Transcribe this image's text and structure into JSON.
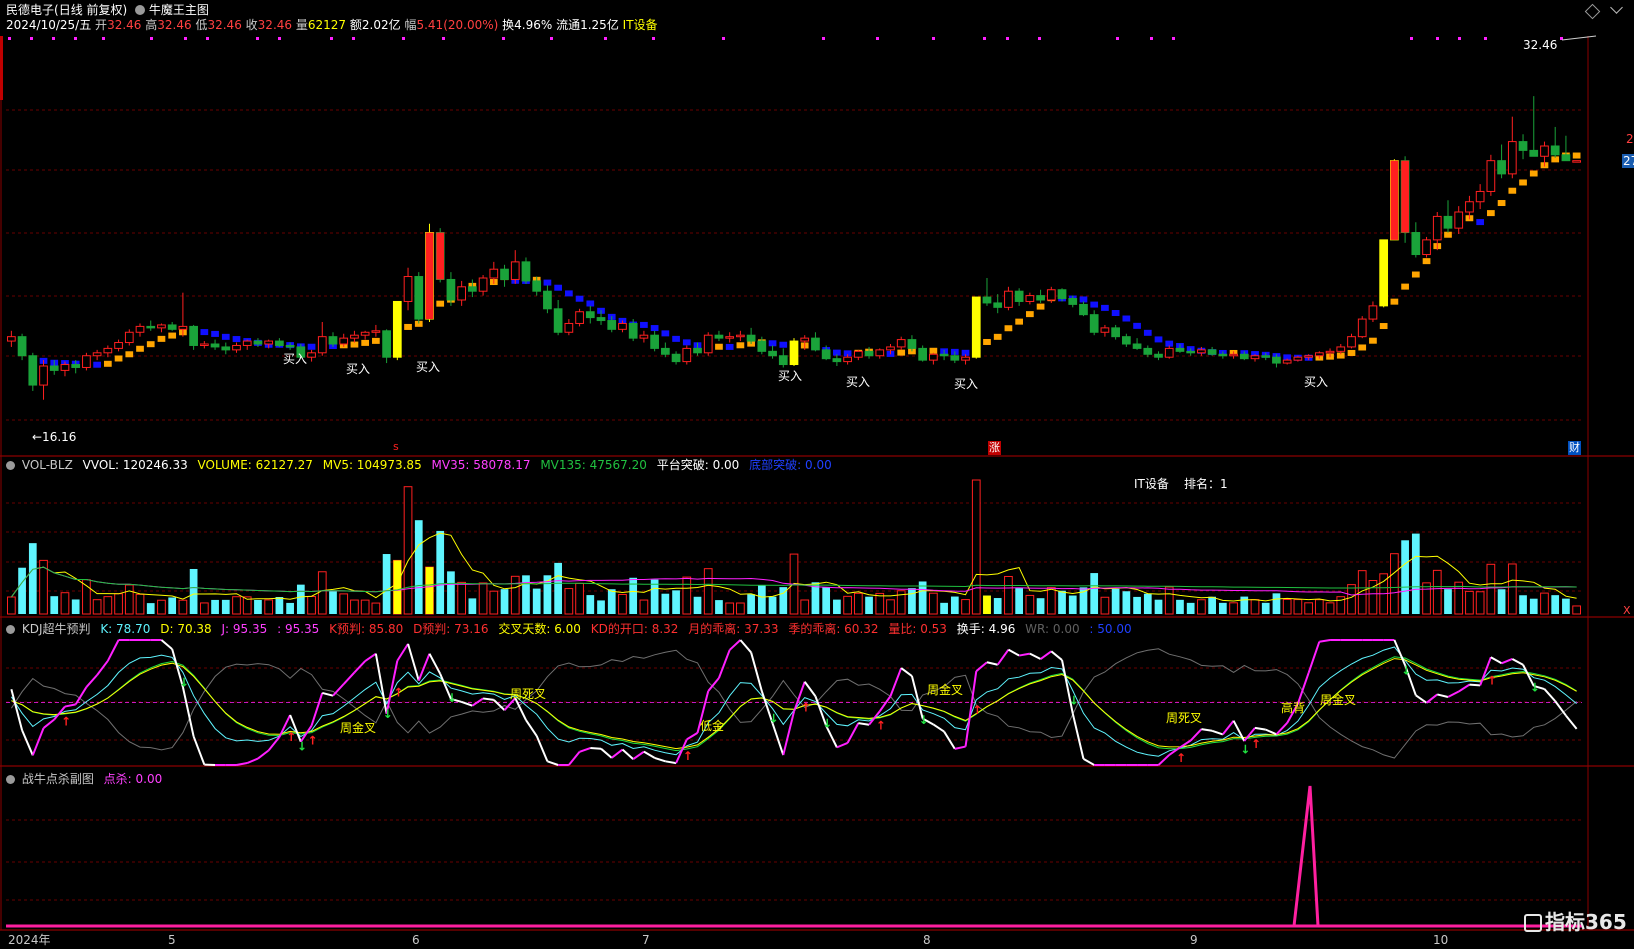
{
  "header": {
    "stock": "民德电子",
    "mode": "(日线 前复权)",
    "indicator": "牛魔王主图",
    "date": "2024/10/25/五",
    "open_label": "开",
    "open": "32.46",
    "high_label": "高",
    "high": "32.46",
    "low_label": "低",
    "low": "32.46",
    "close_label": "收",
    "close": "32.46",
    "vol_label": "量",
    "vol": "62127",
    "amount": "额2.02亿",
    "chg_label": "幅",
    "chg": "5.41(20.00%)",
    "turnover": "换4.96%",
    "float": "流通1.25亿",
    "sector": "IT设备"
  },
  "main_panel": {
    "last_price": "32.46",
    "low_mark": "←16.16",
    "right_edge_label": "27",
    "right_edge_tick": "2",
    "buy_label": "买入",
    "marker_up": "涨",
    "marker_s": "s",
    "marker_fin": "财"
  },
  "vol_panel": {
    "name": "VOL-BLZ",
    "vvol": "VVOL: 120246.33",
    "volume": "VOLUME: 62127.27",
    "mv5": "MV5: 104973.85",
    "mv35": "MV35: 58078.17",
    "mv135": "MV135: 47567.20",
    "platform": "平台突破: 0.00",
    "hidden": "底部突破: 0.00",
    "sector": "IT设备",
    "rank": "排名：1",
    "x_mark": "X"
  },
  "kdj_panel": {
    "name": "KDJ超牛预判",
    "k": "K: 78.70",
    "d": "D: 70.38",
    "j": "J: 95.35",
    "j2": ": 95.35",
    "kpre": "K预判: 85.80",
    "dpre": "D预判: 73.16",
    "cross_days": "交叉天数: 6.00",
    "kd_open": "KD的开口: 8.32",
    "month": "月的乖离: 37.33",
    "season": "季的乖离: 60.32",
    "vr": "量比: 0.53",
    "hand": "换手: 4.96",
    "wr": "WR: 0.00",
    "last": ": 50.00",
    "labels": {
      "week_gold": "周金叉",
      "week_dead": "周死叉",
      "low_gold": "低金",
      "high_dead": "高背"
    }
  },
  "kill_panel": {
    "name": "战牛点杀副图",
    "value": "点杀: 0.00"
  },
  "x_axis": {
    "labels": [
      "2024年",
      "5",
      "6",
      "7",
      "8",
      "9",
      "10"
    ]
  },
  "watermark": "指标365",
  "colors": {
    "up": "#ff2020",
    "down": "#1aa33a",
    "ma_up": "#ffa500",
    "ma_down": "#1010ff",
    "yellow": "#ffff00",
    "cyan": "#5ff5ff",
    "magenta": "#ff20ff",
    "grid": "#8b0000"
  },
  "chart_data": {
    "type": "candlestick",
    "start_date": "2024-04-10",
    "ylim": [
      14,
      41
    ],
    "candles": [
      [
        20.2,
        20.9,
        19.8,
        20.5
      ],
      [
        20.5,
        20.7,
        18.9,
        19.2
      ],
      [
        19.2,
        19.4,
        16.8,
        17.2
      ],
      [
        17.2,
        18.9,
        16.2,
        18.5
      ],
      [
        18.5,
        18.9,
        17.9,
        18.2
      ],
      [
        18.2,
        18.8,
        17.8,
        18.6
      ],
      [
        18.6,
        18.9,
        18.0,
        18.4
      ],
      [
        18.4,
        19.4,
        18.2,
        19.2
      ],
      [
        19.2,
        19.6,
        18.9,
        19.4
      ],
      [
        19.4,
        19.9,
        19.1,
        19.7
      ],
      [
        19.7,
        20.3,
        19.5,
        20.1
      ],
      [
        20.1,
        21.0,
        19.9,
        20.8
      ],
      [
        20.8,
        21.4,
        20.5,
        21.2
      ],
      [
        21.2,
        21.6,
        20.9,
        21.1
      ],
      [
        21.1,
        21.4,
        20.8,
        21.3
      ],
      [
        21.3,
        21.5,
        20.9,
        21.0
      ],
      [
        21.0,
        23.5,
        20.5,
        21.2
      ],
      [
        21.2,
        21.3,
        19.6,
        19.9
      ],
      [
        19.9,
        20.2,
        19.7,
        20.0
      ],
      [
        20.0,
        20.3,
        19.6,
        19.8
      ],
      [
        19.8,
        20.1,
        19.3,
        19.6
      ],
      [
        19.6,
        20.1,
        19.4,
        19.9
      ],
      [
        19.9,
        20.3,
        19.6,
        20.2
      ],
      [
        20.2,
        20.4,
        19.8,
        20.0
      ],
      [
        20.0,
        20.3,
        19.7,
        20.2
      ],
      [
        20.2,
        20.4,
        19.8,
        19.9
      ],
      [
        19.9,
        20.1,
        19.6,
        19.8
      ],
      [
        19.8,
        20.0,
        19.0,
        19.1
      ],
      [
        19.1,
        19.6,
        18.8,
        19.4
      ],
      [
        19.4,
        21.5,
        19.2,
        20.5
      ],
      [
        20.5,
        20.8,
        19.8,
        20.0
      ],
      [
        20.0,
        20.7,
        19.8,
        20.4
      ],
      [
        20.4,
        20.9,
        20.1,
        20.6
      ],
      [
        20.6,
        20.9,
        20.3,
        20.8
      ],
      [
        20.8,
        21.3,
        20.5,
        20.9
      ],
      [
        20.9,
        21.0,
        18.7,
        19.1
      ],
      [
        19.1,
        22.9,
        18.9,
        22.9
      ],
      [
        22.9,
        25.2,
        22.3,
        24.6
      ],
      [
        24.6,
        24.9,
        21.4,
        21.7
      ],
      [
        21.7,
        28.2,
        21.5,
        27.6
      ],
      [
        27.6,
        27.9,
        24.2,
        24.4
      ],
      [
        24.4,
        24.9,
        22.6,
        23.0
      ],
      [
        23.0,
        24.3,
        22.6,
        23.9
      ],
      [
        23.9,
        24.4,
        23.2,
        23.6
      ],
      [
        23.6,
        24.7,
        23.3,
        24.5
      ],
      [
        24.5,
        25.6,
        24.1,
        25.1
      ],
      [
        25.1,
        25.4,
        23.9,
        24.4
      ],
      [
        24.4,
        26.4,
        24.1,
        25.6
      ],
      [
        25.6,
        25.9,
        24.1,
        24.3
      ],
      [
        24.3,
        24.6,
        23.3,
        23.6
      ],
      [
        23.6,
        24.0,
        22.1,
        22.4
      ],
      [
        22.4,
        23.0,
        20.6,
        20.8
      ],
      [
        20.8,
        21.7,
        20.6,
        21.4
      ],
      [
        21.4,
        22.4,
        21.2,
        22.2
      ],
      [
        22.2,
        22.6,
        21.4,
        21.8
      ],
      [
        21.8,
        22.3,
        21.3,
        21.6
      ],
      [
        21.6,
        21.9,
        20.8,
        21.0
      ],
      [
        21.0,
        21.6,
        20.8,
        21.4
      ],
      [
        21.4,
        21.7,
        20.2,
        20.4
      ],
      [
        20.4,
        20.9,
        20.1,
        20.6
      ],
      [
        20.6,
        20.9,
        19.5,
        19.7
      ],
      [
        19.7,
        20.1,
        19.1,
        19.3
      ],
      [
        19.3,
        19.5,
        18.6,
        18.8
      ],
      [
        18.8,
        19.9,
        18.6,
        19.7
      ],
      [
        19.7,
        20.1,
        19.2,
        19.4
      ],
      [
        19.4,
        20.8,
        19.2,
        20.6
      ],
      [
        20.6,
        20.9,
        20.2,
        20.4
      ],
      [
        20.4,
        20.8,
        20.1,
        20.5
      ],
      [
        20.5,
        20.9,
        20.2,
        20.6
      ],
      [
        20.6,
        21.1,
        20.0,
        20.2
      ],
      [
        20.2,
        20.5,
        19.3,
        19.5
      ],
      [
        19.5,
        19.9,
        19.0,
        19.2
      ],
      [
        19.2,
        19.7,
        18.4,
        18.6
      ],
      [
        18.6,
        20.4,
        18.5,
        20.2
      ],
      [
        20.2,
        20.6,
        19.6,
        20.4
      ],
      [
        20.4,
        20.8,
        19.5,
        19.6
      ],
      [
        19.6,
        19.9,
        18.9,
        19.0
      ],
      [
        19.0,
        19.3,
        18.5,
        18.8
      ],
      [
        18.8,
        19.3,
        18.6,
        19.1
      ],
      [
        19.1,
        19.6,
        18.9,
        19.5
      ],
      [
        19.5,
        19.8,
        19.0,
        19.2
      ],
      [
        19.2,
        19.7,
        19.0,
        19.6
      ],
      [
        19.6,
        20.0,
        19.3,
        19.8
      ],
      [
        19.8,
        20.5,
        19.6,
        20.3
      ],
      [
        20.3,
        20.6,
        19.5,
        19.7
      ],
      [
        19.7,
        19.9,
        18.8,
        18.9
      ],
      [
        18.9,
        19.4,
        18.6,
        19.3
      ],
      [
        19.3,
        19.6,
        18.9,
        19.2
      ],
      [
        19.2,
        19.5,
        18.7,
        18.9
      ],
      [
        18.9,
        19.3,
        18.6,
        19.1
      ],
      [
        19.1,
        23.2,
        19.0,
        23.2
      ],
      [
        23.2,
        24.5,
        22.6,
        22.8
      ],
      [
        22.8,
        23.4,
        22.1,
        22.5
      ],
      [
        22.5,
        23.9,
        22.3,
        23.6
      ],
      [
        23.6,
        23.8,
        22.6,
        22.9
      ],
      [
        22.9,
        23.5,
        22.7,
        23.3
      ],
      [
        23.3,
        23.7,
        22.8,
        23.0
      ],
      [
        23.0,
        23.9,
        22.8,
        23.7
      ],
      [
        23.7,
        23.8,
        22.9,
        23.1
      ],
      [
        23.1,
        23.3,
        22.5,
        22.7
      ],
      [
        22.7,
        22.9,
        21.9,
        22.0
      ],
      [
        22.0,
        22.3,
        20.6,
        20.8
      ],
      [
        20.8,
        21.3,
        20.5,
        21.1
      ],
      [
        21.1,
        21.3,
        20.3,
        20.5
      ],
      [
        20.5,
        20.7,
        19.8,
        20.0
      ],
      [
        20.0,
        20.4,
        19.6,
        19.7
      ],
      [
        19.7,
        19.9,
        19.1,
        19.3
      ],
      [
        19.3,
        19.5,
        18.9,
        19.1
      ],
      [
        19.1,
        19.9,
        19.0,
        19.7
      ],
      [
        19.7,
        20.0,
        19.4,
        19.5
      ],
      [
        19.5,
        19.7,
        19.2,
        19.4
      ],
      [
        19.4,
        19.8,
        19.2,
        19.6
      ],
      [
        19.6,
        19.8,
        19.2,
        19.3
      ],
      [
        19.3,
        19.5,
        19.0,
        19.2
      ],
      [
        19.2,
        19.5,
        19.0,
        19.3
      ],
      [
        19.3,
        19.5,
        18.9,
        19.0
      ],
      [
        19.0,
        19.3,
        18.8,
        19.2
      ],
      [
        19.2,
        19.4,
        18.9,
        19.1
      ],
      [
        19.1,
        19.3,
        18.4,
        18.7
      ],
      [
        18.7,
        19.0,
        18.6,
        18.9
      ],
      [
        18.9,
        19.2,
        18.8,
        19.1
      ],
      [
        19.1,
        19.3,
        18.9,
        19.2
      ],
      [
        19.2,
        19.5,
        19.0,
        19.4
      ],
      [
        19.4,
        19.7,
        19.1,
        19.5
      ],
      [
        19.5,
        20.0,
        19.3,
        19.8
      ],
      [
        19.8,
        20.7,
        19.7,
        20.5
      ],
      [
        20.5,
        21.9,
        20.4,
        21.7
      ],
      [
        21.7,
        22.9,
        21.5,
        22.6
      ],
      [
        22.6,
        27.1,
        22.5,
        27.1
      ],
      [
        27.1,
        32.6,
        27.1,
        32.5
      ],
      [
        32.5,
        32.8,
        26.9,
        27.6
      ],
      [
        27.6,
        28.3,
        25.9,
        26.1
      ],
      [
        26.1,
        27.3,
        25.9,
        27.1
      ],
      [
        27.1,
        29.0,
        26.4,
        28.7
      ],
      [
        28.7,
        29.8,
        27.6,
        27.9
      ],
      [
        27.9,
        29.4,
        27.5,
        29.0
      ],
      [
        29.0,
        30.1,
        28.5,
        29.7
      ],
      [
        29.7,
        30.9,
        29.2,
        30.4
      ],
      [
        30.4,
        32.9,
        30.1,
        32.5
      ],
      [
        32.5,
        33.6,
        31.3,
        31.6
      ],
      [
        31.6,
        35.5,
        31.3,
        33.8
      ],
      [
        33.8,
        34.3,
        32.6,
        33.2
      ],
      [
        33.2,
        36.9,
        33.0,
        32.8
      ],
      [
        32.8,
        33.8,
        32.1,
        33.5
      ],
      [
        33.5,
        34.8,
        32.7,
        32.9
      ],
      [
        32.9,
        34.2,
        32.5,
        32.5
      ],
      [
        32.5,
        32.5,
        32.5,
        32.5
      ]
    ]
  }
}
